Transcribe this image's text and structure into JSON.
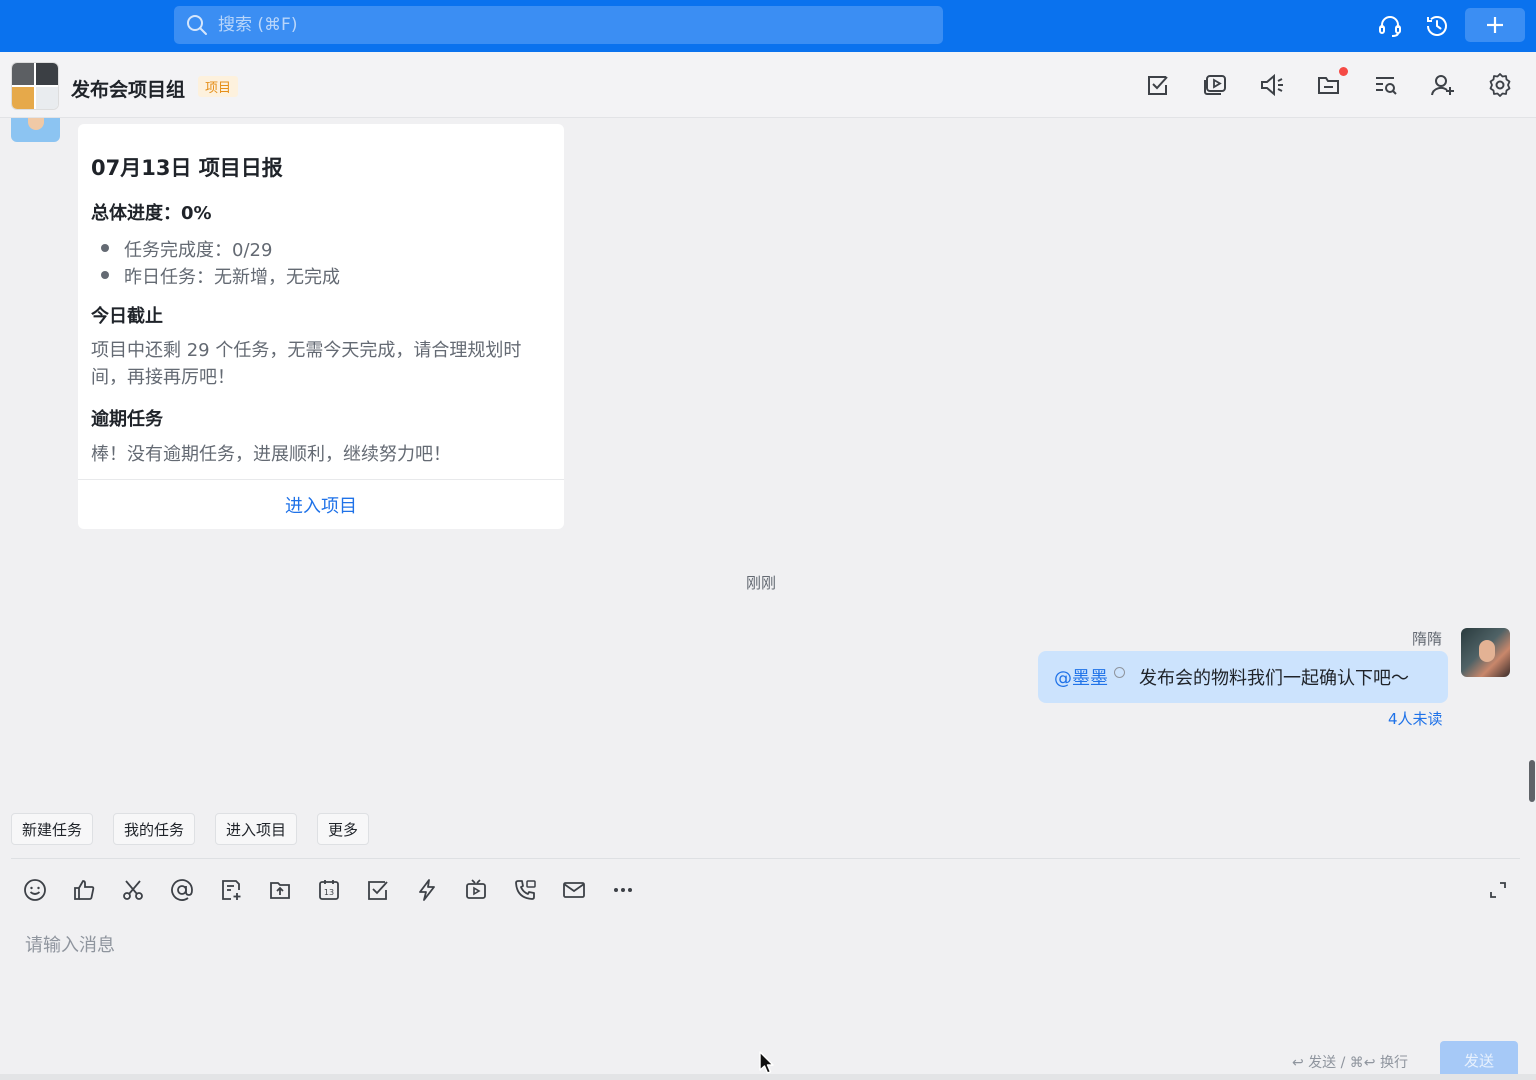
{
  "topbar": {
    "search_placeholder": "搜索 (⌘F)"
  },
  "header": {
    "title": "发布会项目组",
    "badge": "项目"
  },
  "card": {
    "title": "07月13日 项目日报",
    "overall_progress": "总体进度：0%",
    "bullets": [
      "任务完成度：0/29",
      "昨日任务：无新增，无完成"
    ],
    "due_today_title": "今日截止",
    "due_today_text": "项目中还剩 29 个任务，无需今天完成，请合理规划时间，再接再厉吧！",
    "overdue_title": "逾期任务",
    "overdue_text": "棒！没有逾期任务，进展顺利，继续努力吧！",
    "link_label": "进入项目"
  },
  "chat": {
    "timestamp": "刚刚",
    "sender": "隋隋",
    "mention": "@墨墨",
    "message": "发布会的物料我们一起确认下吧～",
    "unread": "4人未读"
  },
  "quick_actions": [
    "新建任务",
    "我的任务",
    "进入项目",
    "更多"
  ],
  "toolbar_icons": [
    "emoji-icon",
    "thumbs-up-icon",
    "scissors-icon",
    "at-icon",
    "doc-add-icon",
    "upload-icon",
    "calendar-icon",
    "task-check-icon",
    "lightning-icon",
    "video-meeting-icon",
    "phone-icon",
    "mail-icon",
    "more-icon"
  ],
  "calendar_day": "13",
  "composer": {
    "placeholder": "请输入消息",
    "hint": "↩ 发送 / ⌘↩ 换行",
    "send_label": "发送"
  },
  "colors": {
    "brand": "#0a72ee",
    "link": "#1f72e8",
    "bubble": "#cce3fd",
    "badge": "#e58f19",
    "dot": "#f54a45"
  }
}
